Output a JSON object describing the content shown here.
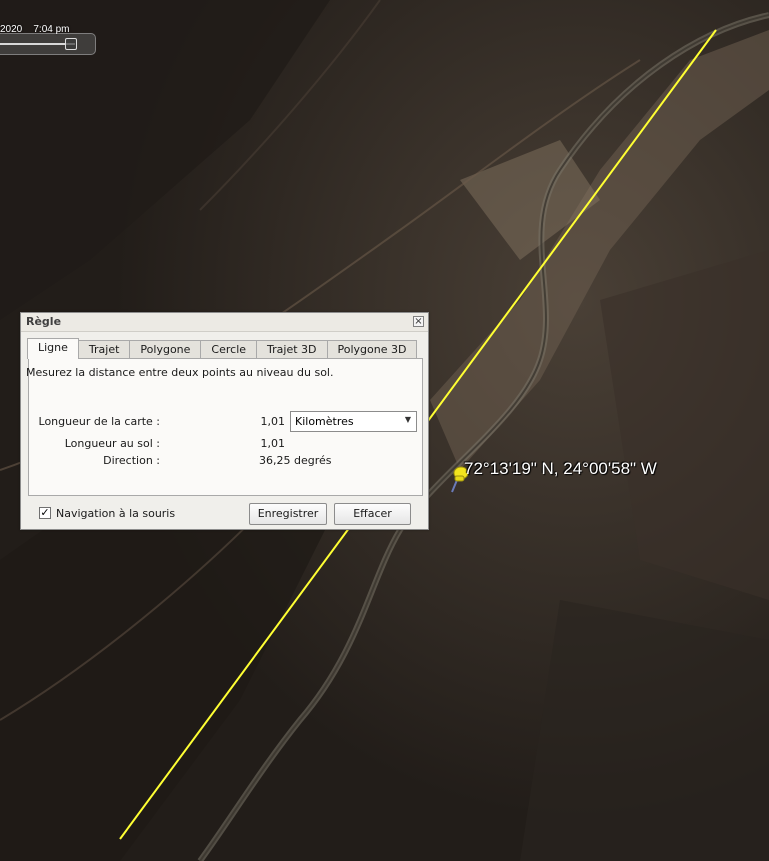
{
  "timeline": {
    "time_text": "2020    7:04 pm"
  },
  "placemark": {
    "label": "72°13'19\" N, 24°00'58\" W",
    "icon": "yellow-pushpin-icon"
  },
  "dialog": {
    "title": "Règle",
    "close_icon": "close-icon",
    "tabs": [
      {
        "label": "Ligne",
        "active": true
      },
      {
        "label": "Trajet",
        "active": false
      },
      {
        "label": "Polygone",
        "active": false
      },
      {
        "label": "Cercle",
        "active": false
      },
      {
        "label": "Trajet 3D",
        "active": false
      },
      {
        "label": "Polygone 3D",
        "active": false
      }
    ],
    "description": "Mesurez la distance entre deux points au niveau du sol.",
    "map_length": {
      "label": "Longueur de la carte :",
      "value": "1,01",
      "unit": "Kilomètres"
    },
    "ground_length": {
      "label": "Longueur au sol :",
      "value": "1,01"
    },
    "heading": {
      "label": "Direction :",
      "value": "36,25 degrés"
    },
    "mouse_nav": {
      "label": "Navigation à la souris",
      "checked": true
    },
    "save_label": "Enregistrer",
    "clear_label": "Effacer"
  },
  "colors": {
    "measure_line": "#ffff33",
    "pin": "#f2e41e"
  }
}
